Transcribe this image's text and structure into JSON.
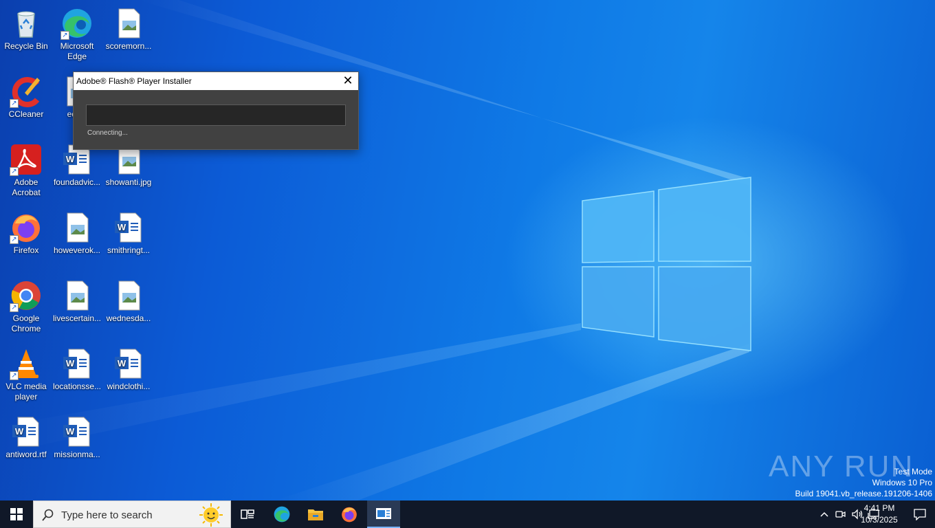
{
  "desktop_icons": [
    {
      "label": "Recycle Bin",
      "icon": "recycle-bin-icon"
    },
    {
      "label": "Microsoft Edge",
      "icon": "edge-icon"
    },
    {
      "label": "scoremorn...",
      "icon": "image-file-icon"
    },
    {
      "label": "CCleaner",
      "icon": "ccleaner-icon"
    },
    {
      "label": "editio",
      "icon": "image-file-icon"
    },
    {
      "label": "Adobe Acrobat",
      "icon": "acrobat-icon"
    },
    {
      "label": "foundadvic...",
      "icon": "word-doc-icon"
    },
    {
      "label": "showanti.jpg",
      "icon": "image-file-icon"
    },
    {
      "label": "Firefox",
      "icon": "firefox-icon"
    },
    {
      "label": "howeverok...",
      "icon": "image-file-icon"
    },
    {
      "label": "smithringt...",
      "icon": "word-doc-icon"
    },
    {
      "label": "Google Chrome",
      "icon": "chrome-icon"
    },
    {
      "label": "livescertain...",
      "icon": "image-file-icon"
    },
    {
      "label": "wednesda...",
      "icon": "image-file-icon"
    },
    {
      "label": "VLC media player",
      "icon": "vlc-icon"
    },
    {
      "label": "locationsse...",
      "icon": "word-doc-icon"
    },
    {
      "label": "windclothi...",
      "icon": "word-doc-icon"
    },
    {
      "label": "antiword.rtf",
      "icon": "word-doc-icon"
    },
    {
      "label": "missionma...",
      "icon": "word-doc-icon"
    }
  ],
  "installer": {
    "title": "Adobe® Flash® Player Installer",
    "status": "Connecting...",
    "progress": 0
  },
  "watermark": {
    "brand": "ANY RUN",
    "line1": "Test Mode",
    "line2": "Windows 10 Pro",
    "line3": "Build 19041.vb_release.191206-1406"
  },
  "taskbar": {
    "search_placeholder": "Type here to search",
    "time": "4:41 PM",
    "date": "10/3/2025",
    "apps": [
      "task-view-icon",
      "edge-icon",
      "file-explorer-icon",
      "firefox-icon",
      "installer-app-icon"
    ]
  },
  "colors": {
    "accent": "#0078d7",
    "taskbar": "#101828"
  }
}
